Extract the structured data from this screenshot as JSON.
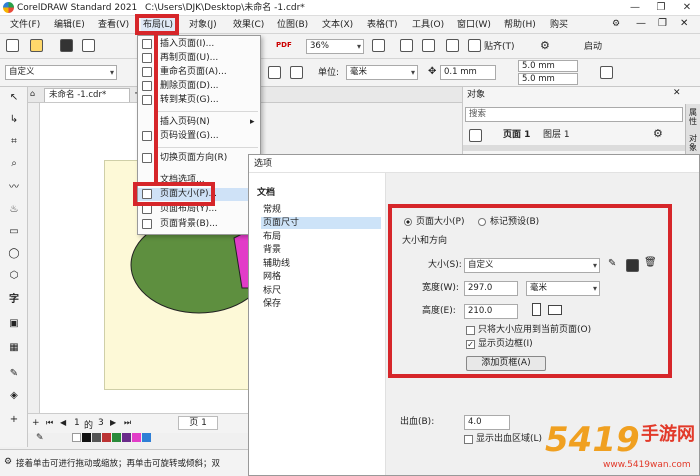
{
  "window": {
    "app_title": "CorelDRAW Standard 2021",
    "file_path": "C:\\Users\\DJK\\Desktop\\未命名 -1.cdr*",
    "controls": [
      "—",
      "❐",
      "✕"
    ]
  },
  "menubar": {
    "items": [
      "文件(F)",
      "编辑(E)",
      "查看(V)",
      "布局(L)",
      "对象(J)",
      "效果(C)",
      "位图(B)",
      "文本(X)",
      "表格(T)",
      "工具(O)",
      "窗口(W)",
      "帮助(H)",
      "购买"
    ]
  },
  "toolbar1": {
    "zoom": "36%",
    "paste_label": "贴齐(T)",
    "launch_label": "启动"
  },
  "toolbar2": {
    "preset": "自定义",
    "units_label": "单位:",
    "units": "毫米",
    "nudge": "0.1 mm",
    "dup_x": "5.0 mm",
    "dup_y": "5.0 mm"
  },
  "doc_tab": "未命名 -1.cdr*",
  "layout_menu": {
    "items": [
      "插入页面(I)...",
      "再制页面(U)...",
      "重命名页面(A)...",
      "删除页面(D)...",
      "转到某页(G)...",
      "插入页码(N)",
      "页码设置(G)...",
      "切换页面方向(R)",
      "文档选项...",
      "页面大小(P)...",
      "页面布局(Y)...",
      "页面背景(B)..."
    ],
    "arrow": "▸"
  },
  "objects_panel": {
    "title": "对象",
    "search_placeholder": "搜索",
    "page": "页面 1",
    "layer": "图层 1",
    "side_tabs": [
      "属性",
      "对象"
    ]
  },
  "dialog": {
    "title": "选项",
    "section": "文档",
    "tree": [
      "常规",
      "页面尺寸",
      "布局",
      "背景",
      "辅助线",
      "网格",
      "标尺",
      "保存"
    ],
    "radio_page_size": "页面大小(P)",
    "radio_label_preset": "标记预设(B)",
    "group_label": "大小和方向",
    "size_label": "大小(S):",
    "size_value": "自定义",
    "width_label": "宽度(W):",
    "width_value": "297.0",
    "width_unit": "毫米",
    "height_label": "高度(E):",
    "height_value": "210.0",
    "apply_current_only": "只将大小应用到当前页面(O)",
    "show_page_border": "显示页边框(I)",
    "add_frame_button": "添加页框(A)",
    "bleed_label": "出血(B):",
    "bleed_value": "4.0",
    "show_bleed": "显示出血区域(L)"
  },
  "page_nav": {
    "current": "1",
    "of": "的",
    "total": "3",
    "page_tab": "页 1"
  },
  "status": {
    "hint": "接着单击可进行拖动或缩放；再单击可旋转或倾斜；双"
  },
  "watermark": {
    "big": "5419",
    "brand": "手游网",
    "url": "www.5419wan.com"
  },
  "colors": {
    "accent_red": "#d6262a",
    "page_fill": "#fdf9d7",
    "ellipse_fill": "#5e8f3f",
    "shape_magenta": "#e23cc8"
  }
}
